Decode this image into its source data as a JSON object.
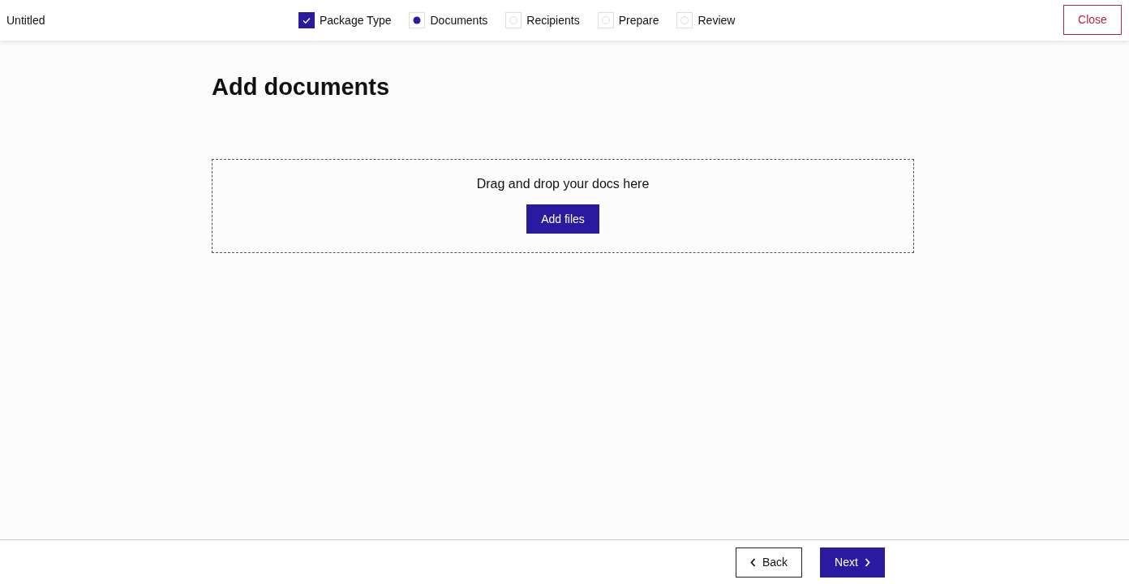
{
  "document_title": "Untitled",
  "steps": [
    {
      "label": "Package Type",
      "completed": true,
      "selected": false
    },
    {
      "label": "Documents",
      "completed": false,
      "selected": true
    },
    {
      "label": "Recipients",
      "completed": false,
      "selected": false
    },
    {
      "label": "Prepare",
      "completed": false,
      "selected": false
    },
    {
      "label": "Review",
      "completed": false,
      "selected": false
    }
  ],
  "close_button": "Close",
  "heading": "Add documents",
  "dropzone": {
    "prompt": "Drag and drop your docs here",
    "button": "Add files"
  },
  "footer": {
    "back": "Back",
    "next": "Next"
  }
}
